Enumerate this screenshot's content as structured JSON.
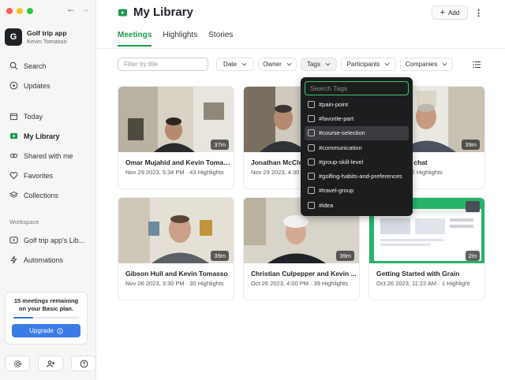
{
  "sidebar": {
    "workspace_initial": "G",
    "workspace_name": "Golf trip app",
    "user_name": "Kevin Tomasso",
    "top_items": [
      {
        "label": "Search",
        "icon": "search-icon"
      },
      {
        "label": "Updates",
        "icon": "updates-icon"
      }
    ],
    "main_items": [
      {
        "label": "Today",
        "icon": "calendar-icon"
      },
      {
        "label": "My Library",
        "icon": "library-icon",
        "active": true
      },
      {
        "label": "Shared with me",
        "icon": "shared-icon"
      },
      {
        "label": "Favorites",
        "icon": "heart-icon"
      },
      {
        "label": "Collections",
        "icon": "collections-icon"
      }
    ],
    "section_label": "Workspace",
    "workspace_items": [
      {
        "label": "Golf trip app's Lib...",
        "icon": "workspace-library-icon"
      },
      {
        "label": "Automations",
        "icon": "bolt-icon"
      }
    ],
    "plan_text": "15 meetings remaining on your Basic plan.",
    "plan_progress": 0.3,
    "upgrade_label": "Upgrade",
    "bottom_icons": [
      "gear-icon",
      "add-user-icon",
      "help-icon"
    ]
  },
  "header": {
    "title": "My Library",
    "add_label": "Add",
    "tabs": [
      {
        "label": "Meetings",
        "active": true
      },
      {
        "label": "Highlights"
      },
      {
        "label": "Stories"
      }
    ]
  },
  "filters": {
    "title_placeholder": "Filter by title",
    "buttons": [
      "Date",
      "Owner",
      "Tags",
      "Participants",
      "Companies"
    ]
  },
  "tags_dropdown": {
    "search_placeholder": "Search Tags",
    "tags": [
      "#pain-point",
      "#favorite-part",
      "#course-selection",
      "#communication",
      "#group-skill-level",
      "#golfing-habits-and-preferences",
      "#travel-group",
      "#idea"
    ],
    "highlighted_index": 2
  },
  "meetings": [
    {
      "title": "Omar Mujahid and Kevin Tomasso",
      "meta": "Nov 29 2023, 5:34 PM · 43 Highlights",
      "duration": "37m"
    },
    {
      "title": "Jonathan McClel...",
      "meta": "Nov 29 2023, 4:30",
      "duration": ""
    },
    {
      "title": "...sso - golf chat",
      "meta": "...9:00 AM · 42 Highlights",
      "duration": "39m"
    },
    {
      "title": "Gibson Hull and Kevin Tomasso",
      "meta": "Nov 06 2023, 3:30 PM · 30 Highlights",
      "duration": "39m"
    },
    {
      "title": "Christian Culpepper and Kevin ...",
      "meta": "Oct 26 2023, 4:00 PM · 39 Highlights",
      "duration": "39m"
    },
    {
      "title": "Getting Started with Grain",
      "meta": "Oct 26 2023, 11:22 AM · 1 Highlight",
      "duration": "2m"
    }
  ],
  "colors": {
    "accent": "#1f9a4f",
    "upgrade": "#3a7be8"
  }
}
